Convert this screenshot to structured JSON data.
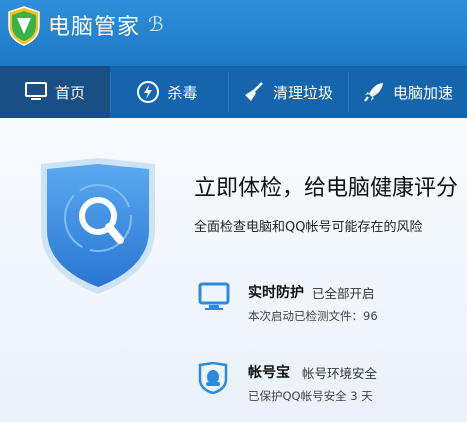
{
  "app": {
    "title": "电脑管家"
  },
  "nav": {
    "tabs": [
      {
        "label": "首页",
        "icon": "monitor-icon",
        "active": true
      },
      {
        "label": "杀毒",
        "icon": "lightning-icon",
        "active": false
      },
      {
        "label": "清理垃圾",
        "icon": "broom-icon",
        "active": false
      },
      {
        "label": "电脑加速",
        "icon": "rocket-icon",
        "active": false
      }
    ]
  },
  "main": {
    "headline": "立即体检，给电脑健康评分",
    "subline": "全面检查电脑和QQ帐号可能存在的风险",
    "features": [
      {
        "title": "实时防护",
        "status": "已全部开启",
        "detail": "本次启动已检测文件：96",
        "icon": "monitor-icon"
      },
      {
        "title": "帐号宝",
        "status": "帐号环境安全",
        "detail": "已保护QQ帐号安全 3 天",
        "icon": "qq-penguin-icon"
      }
    ]
  },
  "colors": {
    "header": "#1f78c4",
    "nav": "#1565ad",
    "nav_active": "#1a4f86",
    "accent": "#2d8ae0"
  }
}
